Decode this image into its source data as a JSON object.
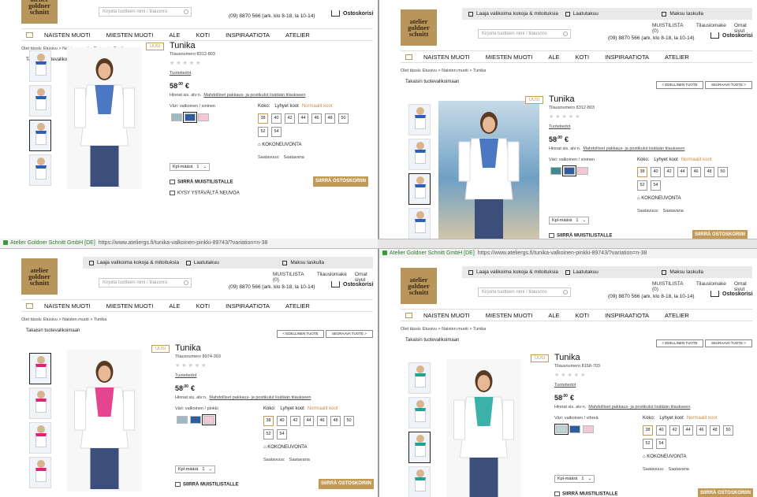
{
  "colors": {
    "accent": "#c39a55",
    "divider": "#9a9a9a"
  },
  "common": {
    "topbar": [
      "Laaja valikoima kokoja & mitoituksia",
      "Laatutakuu",
      "Maksu laskulla"
    ],
    "links": [
      "MUISTILISTA (0)",
      "Tilauslomake",
      "Omat sivut"
    ],
    "search_placeholder": "Kirjoita tuotteen nimi / tilausnro",
    "phone": "(09) 8870 566 (ark. klo 8-18, la 10-14)",
    "cart": "Ostoskorisi",
    "nav": [
      "NAISTEN MUOTI",
      "MIESTEN MUOTI",
      "ALE",
      "KOTI",
      "INSPIRAATIOTA",
      "ATELIER"
    ],
    "crumb": "Olet tässä: Etusivu  >  Naisten muoti  >  Puserot  >  Tunika",
    "crumb_short": "Olet tässä: Etusivu  >  Naisten muoti  >  Tunika",
    "back": "Takaisin tuotevalikoimaan",
    "prev": "< EDELLINEN TUOTE",
    "next": "SEURAAVA TUOTE >",
    "new_badge": "UUSI",
    "product_title": "Tunika",
    "details": "Tuotetiedot",
    "price_whole": "58",
    "price_dec": ",00",
    "price_cur": "€",
    "price_note_a": "Hinnat sis. alv:n.",
    "price_note_b": "Mahdolliset pakkaus- ja postikulut lisätään tilaukseen",
    "size_label": "Koko:",
    "short_sizes": "Lyhyet koot",
    "normal_sizes": "Normaalit koot",
    "sizes": [
      "38",
      "40",
      "42",
      "44",
      "46",
      "48",
      "50",
      "52",
      "54"
    ],
    "size_guide": "KOKONEUVONTA",
    "availability_label": "Saatavuus:",
    "availability": "Saatavana",
    "qty_label": "Kpl-määrä",
    "qty_value": "1",
    "memo": "SIIRRÄ MUISTILISTALLE",
    "add_to_cart": "SIIRRÄ OSTOSKORIIN",
    "ask_friend": "KYSY YSTÄVÄLTÄ NEUVOA",
    "url_site": "Atelier Goldner Schnitt GmbH [DE]",
    "url": "https://www.ateliergs.fi/tunika-valkoinen-pinkki-89743/?variation=n-38",
    "logo": [
      "atelier",
      "goldner",
      "schnitt"
    ]
  },
  "panels": [
    {
      "order": "Tilausnumero 8312-803",
      "color": "Väri: valkoinen / sininen",
      "swatches": [
        "#9fb9c4",
        "#2f5d9e",
        "#f2c7d8"
      ],
      "sel": 1,
      "accent": "#2c5fb8"
    },
    {
      "order": "Tilausnumero 8312-803",
      "color": "Väri: valkoinen / sininen",
      "swatches": [
        "#3f8a8a",
        "#2f5d9e",
        "#f2c7d8"
      ],
      "sel": 1,
      "accent": "#2c5fb8"
    },
    {
      "order": "Tilausnumero 8974-303",
      "color": "Väri: valkoinen / pinkki",
      "swatches": [
        "#9fb9c4",
        "#2f5d9e",
        "#f2c7d8"
      ],
      "sel": 2,
      "accent": "#e0237a"
    },
    {
      "order": "Tilausnumero 8158-703",
      "color": "Väri: valkoinen / vihreä",
      "swatches": [
        "#bcd4d4",
        "#2f5d9e",
        "#f2c7d8"
      ],
      "sel": 0,
      "accent": "#1aa39a"
    }
  ]
}
